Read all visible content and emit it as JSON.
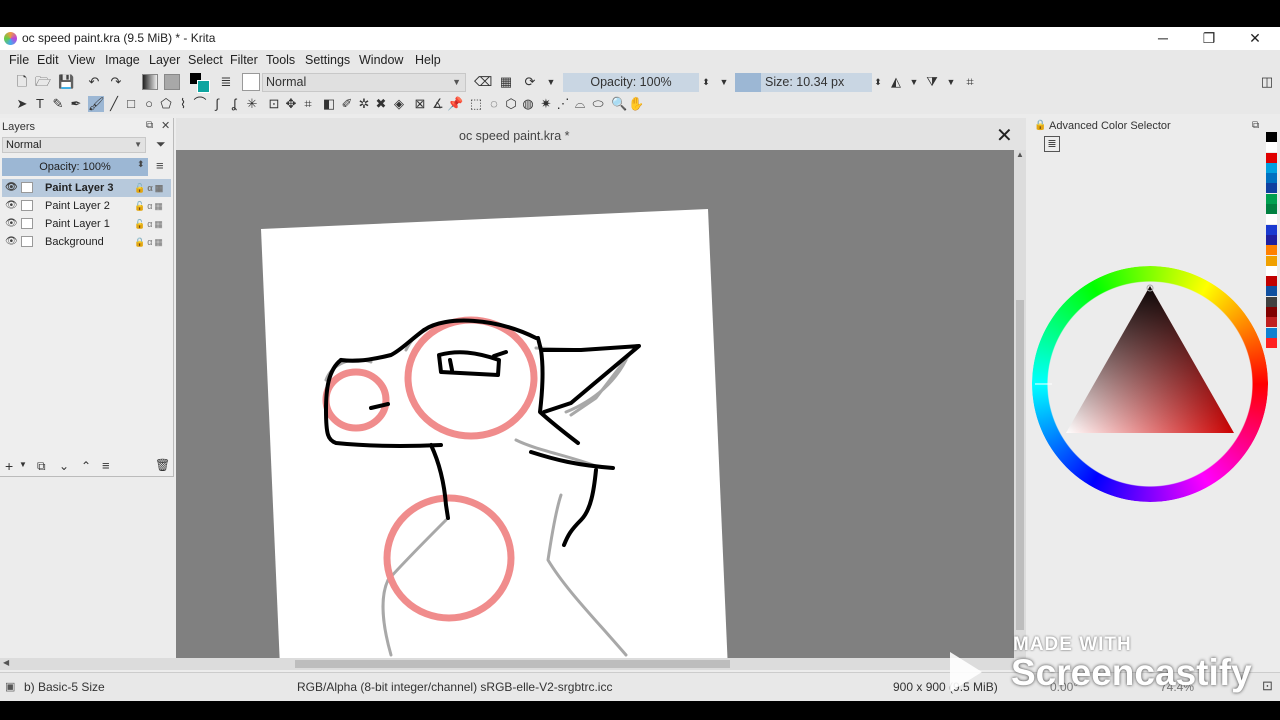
{
  "window": {
    "title": "oc speed paint.kra (9.5 MiB)  * - Krita",
    "minimize": "─",
    "restore": "❐",
    "close": "✕"
  },
  "menu": [
    "File",
    "Edit",
    "View",
    "Image",
    "Layer",
    "Select",
    "Filter",
    "Tools",
    "Settings",
    "Window",
    "Help"
  ],
  "toolbar": {
    "blend_mode": "Normal",
    "opacity_label": "Opacity: 100%",
    "size_label": "Size: 10.34 px"
  },
  "layers_docker": {
    "title": "Layers",
    "blend_mode": "Normal",
    "opacity_label": "Opacity:  100%",
    "layers": [
      {
        "name": "Paint Layer 3",
        "selected": true
      },
      {
        "name": "Paint Layer 2",
        "selected": false
      },
      {
        "name": "Paint Layer 1",
        "selected": false
      },
      {
        "name": "Background",
        "selected": false
      }
    ]
  },
  "document": {
    "tab_title": "oc speed paint.kra *"
  },
  "color_selector": {
    "title": "Advanced Color Selector",
    "swatches": [
      "#000000",
      "#ffffff",
      "#e00000",
      "#00a0e0",
      "#0070c0",
      "#1040a0",
      "#00a050",
      "#008040",
      "#ffffff",
      "#1a3ad0",
      "#2020a0",
      "#ff8000",
      "#f0a000",
      "#ffffff",
      "#c00000",
      "#1050a0",
      "#404040",
      "#800000",
      "#c02020",
      "#1080d0",
      "#ff2020"
    ]
  },
  "status": {
    "brush": "b) Basic-5 Size",
    "color_space": "RGB/Alpha (8-bit integer/channel)  sRGB-elle-V2-srgbtrc.icc",
    "dimensions": "900 x 900 (9.5 MiB)",
    "rotation": "0.00°",
    "zoom": "74.4%"
  },
  "watermark": {
    "made_with": "MADE WITH",
    "brand": "Screencastify"
  },
  "colors": {
    "accent": "#9cb7d4",
    "canvas_bg": "#808080",
    "sketch_red": "#f08c8c",
    "sketch_gray": "#a8a8a8"
  }
}
